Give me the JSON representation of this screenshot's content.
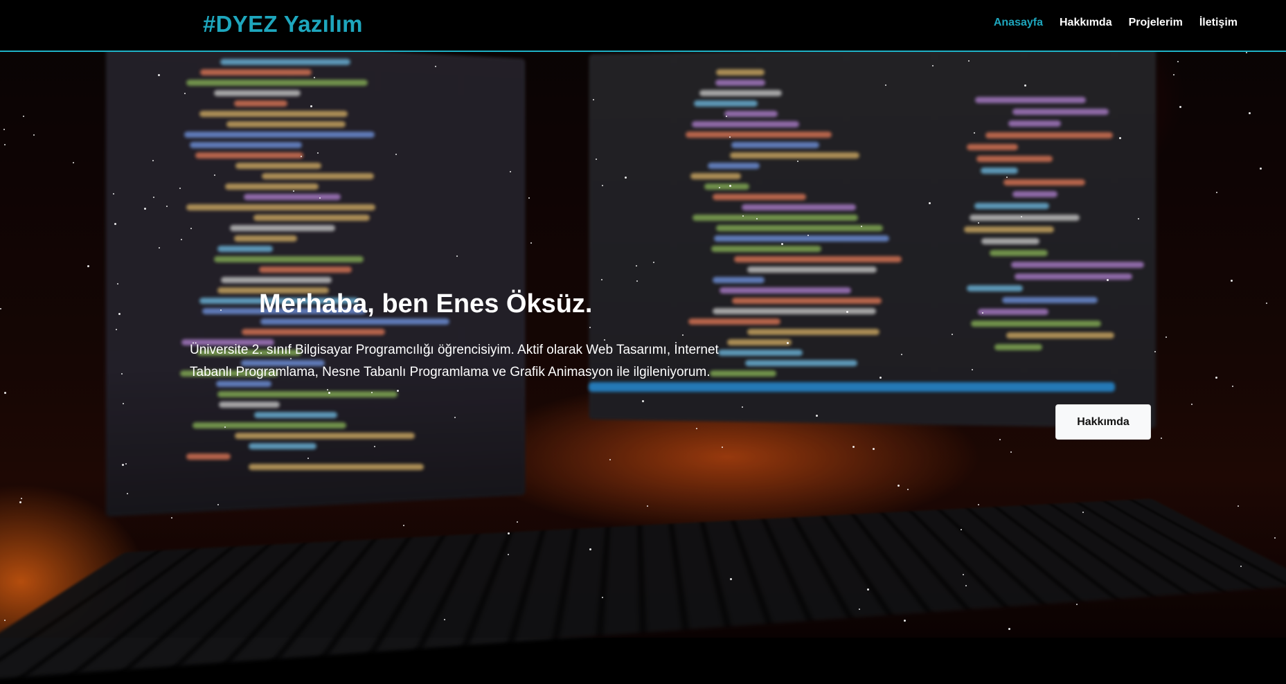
{
  "header": {
    "logo": "#DYEZ Yazılım",
    "nav": [
      {
        "label": "Anasayfa",
        "active": true
      },
      {
        "label": "Hakkımda",
        "active": false
      },
      {
        "label": "Projelerim",
        "active": false
      },
      {
        "label": "İletişim",
        "active": false
      }
    ]
  },
  "hero": {
    "title": "Merhaba, ben Enes Öksüz.",
    "description": "Üniversite 2. sınıf Bilgisayar Programcılığı öğrencisiyim. Aktif olarak Web Tasarımı, İnternet Tabanlı Programlama, Nesne Tabanlı Programlama ve Grafik Animasyon ile ilgileniyorum.",
    "button_label": "Hakkımda"
  },
  "colors": {
    "accent": "#1ea6bd",
    "header_background": "#000000",
    "button_background": "#f8f9fa"
  }
}
